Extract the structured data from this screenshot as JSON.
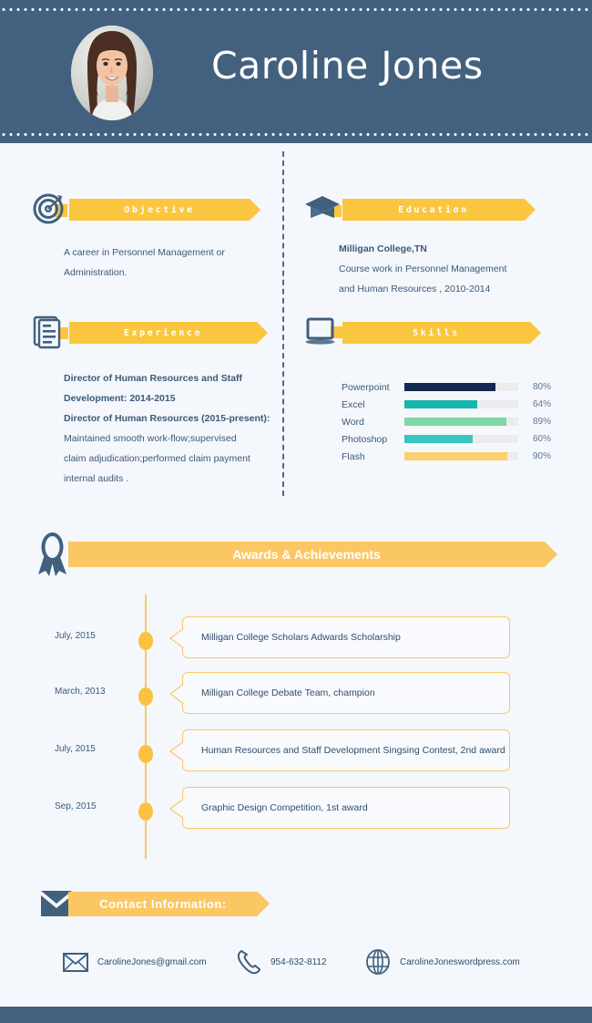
{
  "header": {
    "name": "Caroline Jones",
    "avatar_icon": "portrait-photo"
  },
  "sections": {
    "objective": {
      "title": "Objective",
      "icon": "target-dart-icon",
      "lines": [
        "A career in Personnel Management or",
        "Administration."
      ]
    },
    "education": {
      "title": "Education",
      "icon": "graduation-cap-icon",
      "lines": [
        "Milligan College,TN",
        "Course work in Personnel Management",
        "and Human Resources , 2010-2014"
      ],
      "bold_lines": [
        0
      ]
    },
    "experience": {
      "title": "Experience",
      "icon": "document-list-icon",
      "lines": [
        "Director of Human Resources and Staff",
        "Development: 2014-2015",
        "Director of Human Resources (2015-present):",
        "Maintained smooth work-flow;supervised",
        "claim adjudication;performed claim payment",
        "internal audits ."
      ],
      "bold_lines": [
        0,
        1,
        2
      ]
    },
    "skills": {
      "title": "Skills",
      "icon": "laptop-icon"
    },
    "awards": {
      "title": "Awards & Achievements",
      "icon": "award-medal-icon"
    },
    "contact": {
      "title": "Contact Information:",
      "icon": "envelope-icon"
    }
  },
  "chart_data": {
    "type": "bar",
    "title": "Skills",
    "orientation": "horizontal",
    "categories": [
      "Powerpoint",
      "Excel",
      "Word",
      "Photoshop",
      "Flash"
    ],
    "values": [
      80,
      64,
      89,
      60,
      90
    ],
    "value_labels": [
      "80%",
      "64%",
      "89%",
      "60%",
      "90%"
    ],
    "colors": [
      "#13294f",
      "#17b5ad",
      "#7fd7a6",
      "#36c5c0",
      "#fbd070"
    ],
    "track_color": "#ececec",
    "xlabel": "",
    "ylabel": "",
    "xlim": [
      0,
      100
    ],
    "grid": false,
    "legend": "none"
  },
  "timeline": [
    {
      "date": "July, 2015",
      "text": "Milligan College Scholars Adwards Scholarship"
    },
    {
      "date": "March, 2013",
      "text": "Milligan College Debate Team, champion"
    },
    {
      "date": "July, 2015",
      "text": "Human Resources and Staff Development Singsing Contest, 2nd award"
    },
    {
      "date": "Sep, 2015",
      "text": "Graphic Design Competition, 1st award"
    }
  ],
  "contact_items": [
    {
      "icon": "email-icon",
      "text": "CarolineJones@gmail.com"
    },
    {
      "icon": "phone-icon",
      "text": "954-632-8112"
    },
    {
      "icon": "globe-icon",
      "text": "CarolineJoneswordpress.com"
    }
  ],
  "colors": {
    "navy": "#43617e",
    "yellow": "#fbc63f",
    "yellow_light": "#fbc763",
    "page_bg": "#f4f7fc",
    "text": "#3a5a78"
  }
}
